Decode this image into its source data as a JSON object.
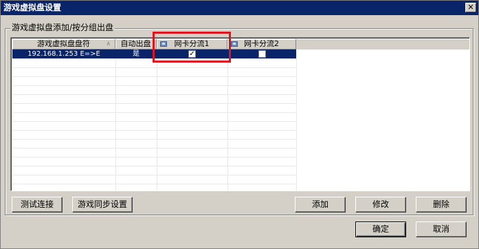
{
  "window": {
    "title": "游戏虚拟盘设置",
    "close_label": "✕"
  },
  "group": {
    "legend": "游戏虚拟盘添加/按分组出盘"
  },
  "grid": {
    "columns": [
      {
        "label": "游戏虚拟盘盘符",
        "sort_indicator": "∧"
      },
      {
        "label": "自动出盘"
      },
      {
        "label": "网卡分流1",
        "icon": "column-icon"
      },
      {
        "label": "网卡分流2",
        "icon": "column-icon"
      }
    ],
    "rows": [
      {
        "drive": "192.168.1.253 E=>E",
        "auto": "是",
        "nic1": true,
        "nic2": false,
        "nic1_mark": "✓"
      }
    ]
  },
  "buttons": {
    "test": "测试连接",
    "sync": "游戏同步设置",
    "add": "添加",
    "edit": "修改",
    "delete": "删除",
    "ok": "确定",
    "cancel": "取消"
  },
  "colors": {
    "selection": "#0a246a",
    "highlight_box": "#e0141e",
    "dialog_bg": "#d4d0c8"
  }
}
